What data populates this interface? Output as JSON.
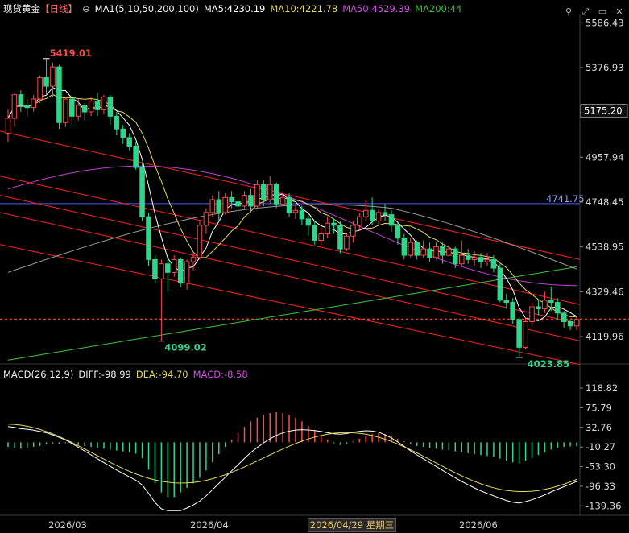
{
  "header": {
    "symbol": "现货黄金",
    "period": "【日线】",
    "ma_label": "MA1(5,10,50,200,100)",
    "ma5": "MA5:4230.19",
    "ma10": "MA10:4221.78",
    "ma50": "MA50:4529.39",
    "ma200": "MA200:44"
  },
  "macd_header": {
    "label": "MACD(26,12,9)",
    "diff": "DIFF:-98.99",
    "dea": "DEA:-94.70",
    "macd": "MACD:-8.58"
  },
  "icons": [
    "search-icon",
    "expand-icon",
    "window-icon",
    "close-icon"
  ],
  "colors": {
    "up": "#ff4a4a",
    "down": "#2fd58a",
    "ma5": "#ffffff",
    "ma10": "#e6d85c",
    "ma50": "#c040d0",
    "ma200": "#3cc43c",
    "ma100": "#9a9a9a",
    "channel": "#ff2020",
    "hline": "#4a5cff"
  },
  "chart_data": [
    {
      "type": "candlestick",
      "y_ticks": [
        "5586.43",
        "5376.93",
        "5167.44",
        "4957.94",
        "4748.45",
        "4538.95",
        "4329.46",
        "4119.96"
      ],
      "ylim": [
        4000,
        5610
      ],
      "annotations": {
        "high": "5419.01",
        "low1": "4099.02",
        "low2": "4023.85",
        "hline": "4741.75",
        "last_price": "5175.20"
      },
      "candles": [
        [
          5070,
          5140,
          5030,
          5180
        ],
        [
          5140,
          5250,
          5100,
          5260
        ],
        [
          5250,
          5200,
          5170,
          5270
        ],
        [
          5200,
          5190,
          5150,
          5230
        ],
        [
          5190,
          5230,
          5170,
          5250
        ],
        [
          5230,
          5330,
          5210,
          5340
        ],
        [
          5330,
          5290,
          5250,
          5419
        ],
        [
          5290,
          5380,
          5240,
          5400
        ],
        [
          5380,
          5120,
          5090,
          5390
        ],
        [
          5120,
          5230,
          5100,
          5240
        ],
        [
          5230,
          5150,
          5110,
          5250
        ],
        [
          5150,
          5200,
          5130,
          5230
        ],
        [
          5200,
          5170,
          5130,
          5210
        ],
        [
          5170,
          5220,
          5150,
          5240
        ],
        [
          5220,
          5180,
          5150,
          5260
        ],
        [
          5180,
          5240,
          5160,
          5250
        ],
        [
          5240,
          5150,
          5110,
          5250
        ],
        [
          5150,
          5090,
          5060,
          5170
        ],
        [
          5090,
          5050,
          5020,
          5110
        ],
        [
          5050,
          5010,
          4990,
          5070
        ],
        [
          5010,
          4910,
          4900,
          5030
        ],
        [
          4910,
          4680,
          4660,
          4930
        ],
        [
          4680,
          4480,
          4450,
          4700
        ],
        [
          4480,
          4390,
          4370,
          4500
        ],
        [
          4390,
          4460,
          4099,
          4480
        ],
        [
          4460,
          4420,
          4330,
          4490
        ],
        [
          4420,
          4480,
          4400,
          4500
        ],
        [
          4480,
          4370,
          4350,
          4490
        ],
        [
          4370,
          4470,
          4340,
          4480
        ],
        [
          4470,
          4490,
          4430,
          4510
        ],
        [
          4490,
          4640,
          4480,
          4660
        ],
        [
          4640,
          4700,
          4600,
          4720
        ],
        [
          4700,
          4760,
          4680,
          4780
        ],
        [
          4760,
          4700,
          4660,
          4800
        ],
        [
          4700,
          4770,
          4690,
          4790
        ],
        [
          4770,
          4750,
          4720,
          4800
        ],
        [
          4750,
          4730,
          4680,
          4770
        ],
        [
          4730,
          4780,
          4720,
          4800
        ],
        [
          4780,
          4730,
          4700,
          4810
        ],
        [
          4730,
          4830,
          4720,
          4850
        ],
        [
          4830,
          4760,
          4730,
          4850
        ],
        [
          4760,
          4830,
          4740,
          4870
        ],
        [
          4830,
          4740,
          4720,
          4840
        ],
        [
          4740,
          4770,
          4730,
          4800
        ],
        [
          4770,
          4700,
          4680,
          4790
        ],
        [
          4700,
          4710,
          4670,
          4740
        ],
        [
          4710,
          4670,
          4640,
          4730
        ],
        [
          4670,
          4640,
          4590,
          4690
        ],
        [
          4640,
          4570,
          4550,
          4660
        ],
        [
          4570,
          4600,
          4550,
          4630
        ],
        [
          4600,
          4650,
          4580,
          4680
        ],
        [
          4650,
          4640,
          4600,
          4670
        ],
        [
          4640,
          4530,
          4510,
          4660
        ],
        [
          4530,
          4590,
          4520,
          4600
        ],
        [
          4590,
          4640,
          4560,
          4660
        ],
        [
          4640,
          4680,
          4620,
          4700
        ],
        [
          4680,
          4710,
          4660,
          4760
        ],
        [
          4710,
          4660,
          4640,
          4770
        ],
        [
          4660,
          4700,
          4640,
          4720
        ],
        [
          4700,
          4690,
          4660,
          4740
        ],
        [
          4690,
          4640,
          4610,
          4710
        ],
        [
          4640,
          4580,
          4550,
          4660
        ],
        [
          4580,
          4500,
          4480,
          4600
        ],
        [
          4500,
          4560,
          4490,
          4580
        ],
        [
          4560,
          4500,
          4480,
          4570
        ],
        [
          4500,
          4530,
          4490,
          4570
        ],
        [
          4530,
          4490,
          4470,
          4560
        ],
        [
          4490,
          4540,
          4480,
          4560
        ],
        [
          4540,
          4500,
          4460,
          4560
        ],
        [
          4500,
          4530,
          4490,
          4550
        ],
        [
          4530,
          4460,
          4440,
          4540
        ],
        [
          4460,
          4500,
          4450,
          4570
        ],
        [
          4500,
          4480,
          4460,
          4530
        ],
        [
          4480,
          4490,
          4450,
          4520
        ],
        [
          4490,
          4470,
          4440,
          4510
        ],
        [
          4470,
          4480,
          4450,
          4510
        ],
        [
          4480,
          4440,
          4420,
          4500
        ],
        [
          4440,
          4290,
          4280,
          4460
        ],
        [
          4290,
          4280,
          4250,
          4320
        ],
        [
          4280,
          4200,
          4180,
          4300
        ],
        [
          4200,
          4070,
          4023,
          4210
        ],
        [
          4070,
          4190,
          4060,
          4210
        ],
        [
          4190,
          4260,
          4170,
          4280
        ],
        [
          4260,
          4250,
          4220,
          4290
        ],
        [
          4250,
          4290,
          4230,
          4330
        ],
        [
          4290,
          4280,
          4240,
          4350
        ],
        [
          4280,
          4230,
          4200,
          4300
        ],
        [
          4230,
          4190,
          4160,
          4240
        ],
        [
          4190,
          4170,
          4150,
          4200
        ],
        [
          4170,
          4200,
          4150,
          4210
        ]
      ]
    },
    {
      "type": "bar",
      "title": "MACD(26,12,9)",
      "y_ticks": [
        "118.82",
        "75.79",
        "32.76",
        "-10.27",
        "-53.30",
        "-96.33",
        "-139.36"
      ],
      "ylim": [
        -160,
        140
      ],
      "series": [
        {
          "name": "MACD",
          "values": [
            -10,
            -12,
            -14,
            -12,
            -10,
            -8,
            -5,
            -4,
            -3,
            -2,
            -4,
            -6,
            -8,
            -10,
            -12,
            -14,
            -16,
            -18,
            -20,
            -22,
            -25,
            -35,
            -60,
            -90,
            -110,
            -120,
            -120,
            -110,
            -100,
            -90,
            -78,
            -62,
            -44,
            -26,
            -10,
            6,
            20,
            34,
            46,
            54,
            60,
            64,
            66,
            64,
            60,
            54,
            46,
            36,
            26,
            16,
            6,
            -2,
            -6,
            -4,
            2,
            8,
            14,
            18,
            20,
            18,
            14,
            8,
            2,
            -4,
            -8,
            -10,
            -12,
            -14,
            -16,
            -18,
            -20,
            -22,
            -24,
            -26,
            -28,
            -30,
            -32,
            -36,
            -40,
            -44,
            -46,
            -40,
            -34,
            -28,
            -22,
            -16,
            -12,
            -10,
            -9,
            -8.58
          ]
        }
      ]
    }
  ],
  "x_axis": {
    "dates": [
      "2026/03",
      "2026/04",
      "2026/06"
    ],
    "cursor_date": "2026/04/29 星期三"
  }
}
